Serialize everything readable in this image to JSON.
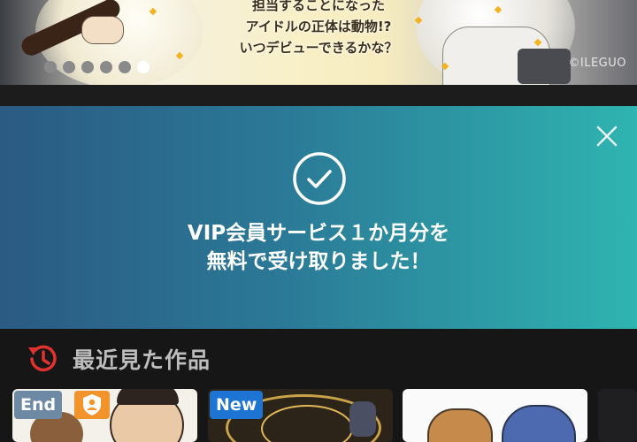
{
  "banner": {
    "caption_lines": [
      "担当することになった",
      "アイドルの正体は動物!?",
      "いつデビューできるかな？"
    ],
    "credit": "©ILEGUO",
    "slide_count": 6,
    "active_slide": 6
  },
  "notice": {
    "message_lines": [
      "VIP会員サービス１か月分を",
      "無料で受け取りました！"
    ],
    "icons": {
      "close": "close-icon",
      "status": "check-circle-icon"
    }
  },
  "recent": {
    "title": "最近見た作品",
    "icon": "history-icon",
    "cards": [
      {
        "badge": "End",
        "badge_color": "#6e89a3",
        "extra_icon": "user-lock-icon"
      },
      {
        "badge": "New",
        "badge_color": "#1e74d2"
      },
      {
        "badge": ""
      },
      {
        "badge": ""
      }
    ]
  },
  "colors": {
    "notice_gradient_start": "#2b5a82",
    "notice_gradient_end": "#2fb4b0",
    "history_icon": "#e0322e",
    "background": "#161616"
  }
}
